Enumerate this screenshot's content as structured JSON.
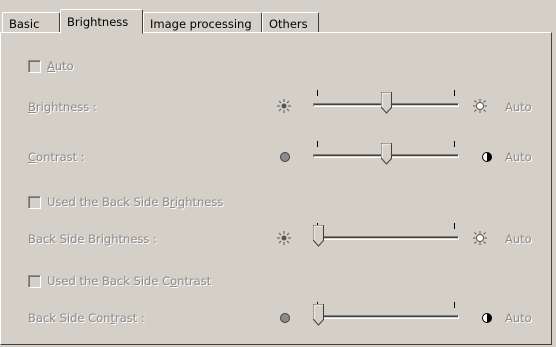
{
  "tabs": [
    {
      "label": "Basic",
      "active": false
    },
    {
      "label": "Brightness",
      "active": true
    },
    {
      "label": "Image processing",
      "active": false
    },
    {
      "label": "Others",
      "active": false
    }
  ],
  "auto_checkbox": {
    "label_u": "A",
    "label_rest": "uto",
    "checked": false
  },
  "brightness": {
    "label_u": "B",
    "label_rest": "rightness :",
    "auto_label": "Auto",
    "level": 0.5
  },
  "contrast": {
    "label_u": "C",
    "label_rest": "ontrast :",
    "auto_label": "Auto",
    "level": 0.5
  },
  "back_brightness_checkbox": {
    "label_a": "Used the Back Side B",
    "label_u": "r",
    "label_b": "ightness",
    "checked": false
  },
  "back_brightness": {
    "label_a": "Back Side Bri",
    "label_u": "g",
    "label_b": "htness :",
    "auto_label": "Auto",
    "level": 0.0
  },
  "back_contrast_checkbox": {
    "label_a": "Used the Back Side C",
    "label_u": "o",
    "label_b": "ntrast",
    "checked": false
  },
  "back_contrast": {
    "label_a": "Back Side Con",
    "label_u": "t",
    "label_b": "rast :",
    "auto_label": "Auto",
    "level": 0.0
  },
  "icons": {
    "brightness_low": "sun-small-icon",
    "brightness_high": "sun-large-icon",
    "contrast_low": "gray-circle-icon",
    "contrast_high": "half-circle-icon"
  }
}
